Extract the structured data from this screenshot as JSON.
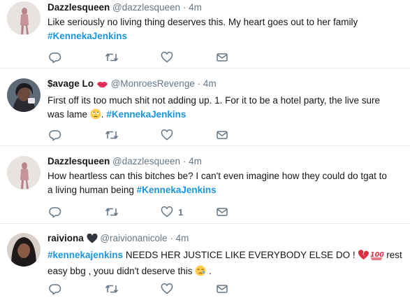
{
  "tweets": [
    {
      "name": "Dazzlesqueen",
      "handle": "@dazzlesqueen",
      "dot": "·",
      "time": "4m",
      "line1": "Like seriously no living thing deserves this. My heart goes out to her family",
      "hashtag": "#KennekaJenkins",
      "avatar": "woman-photo-avatar"
    },
    {
      "name": "$avage Lo",
      "handle": "@MonroesRevenge",
      "dot": "·",
      "time": "4m",
      "line1": "First off its too much shit not adding up. 1. For it to be a hotel party, the live sure",
      "line2_pre": "was lame",
      "line2_mid": ".",
      "hashtag": "#KennekaJenkins",
      "avatar": "selfie-avatar"
    },
    {
      "name": "Dazzlesqueen",
      "handle": "@dazzlesqueen",
      "dot": "·",
      "time": "4m",
      "line1": "How heartless can this bitches be? I can't even imagine how they could do tgat to",
      "line2_pre": "a living human being",
      "hashtag": "#KennekaJenkins",
      "like_count": "1",
      "avatar": "woman-photo-avatar"
    },
    {
      "name": "raiviona",
      "handle": "@raivionanicole",
      "dot": "·",
      "time": "4m",
      "hashtag": "#kennekajenkins",
      "line1_post": "NEEDS HER JUSTICE LIKE EVERYBODY ELSE DO !",
      "line1_tail": "rest",
      "line2": "easy bbg , youu didn't deserve this",
      "line2_end": ".",
      "avatar": "portrait-avatar"
    }
  ],
  "icons": {
    "reply": "reply-icon",
    "retweet": "retweet-icon",
    "like": "heart-icon",
    "message": "envelope-icon"
  },
  "colors": {
    "hashtag": "#1b95e0",
    "meta": "#657786",
    "divider": "#e6ecf0"
  }
}
